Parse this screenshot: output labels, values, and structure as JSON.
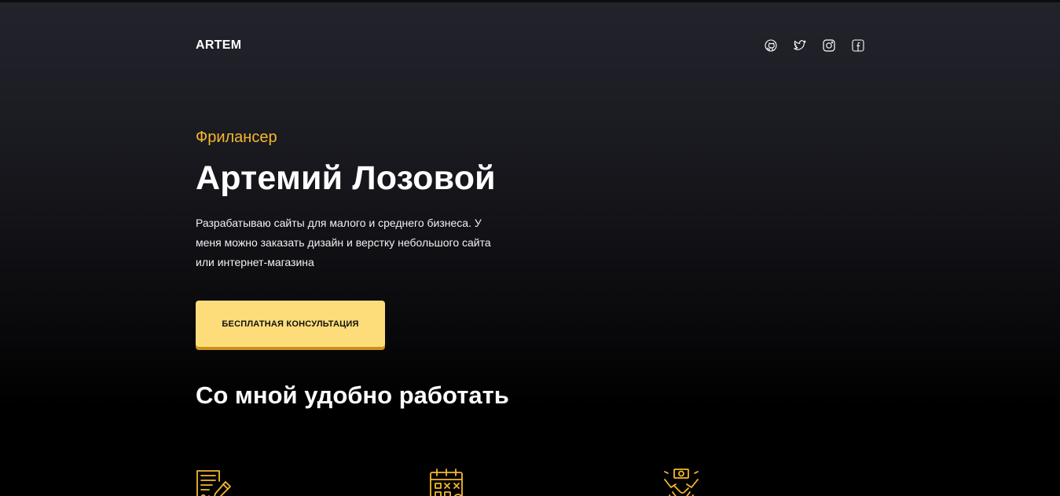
{
  "header": {
    "logo": "ARTEM",
    "socials": [
      {
        "icon": "github-icon"
      },
      {
        "icon": "twitter-icon"
      },
      {
        "icon": "instagram-icon"
      },
      {
        "icon": "facebook-icon"
      }
    ]
  },
  "hero": {
    "subtitle": "Фрилансер",
    "title": "Артемий Лозовой",
    "description": "Разрабатываю сайты для малого и среднего бизнеса. У меня можно заказать дизайн и верстку небольшого сайта или интернет-магазина",
    "cta_label": "БЕСПЛАТНАЯ КОНСУЛЬТАЦИЯ"
  },
  "features": {
    "title": "Со мной удобно работать",
    "icons": [
      "contract-icon",
      "calendar-icon",
      "handshake-money-icon"
    ]
  },
  "colors": {
    "accent": "#f5b82e",
    "button_bg": "#fddd79",
    "button_shadow": "#c99119"
  }
}
